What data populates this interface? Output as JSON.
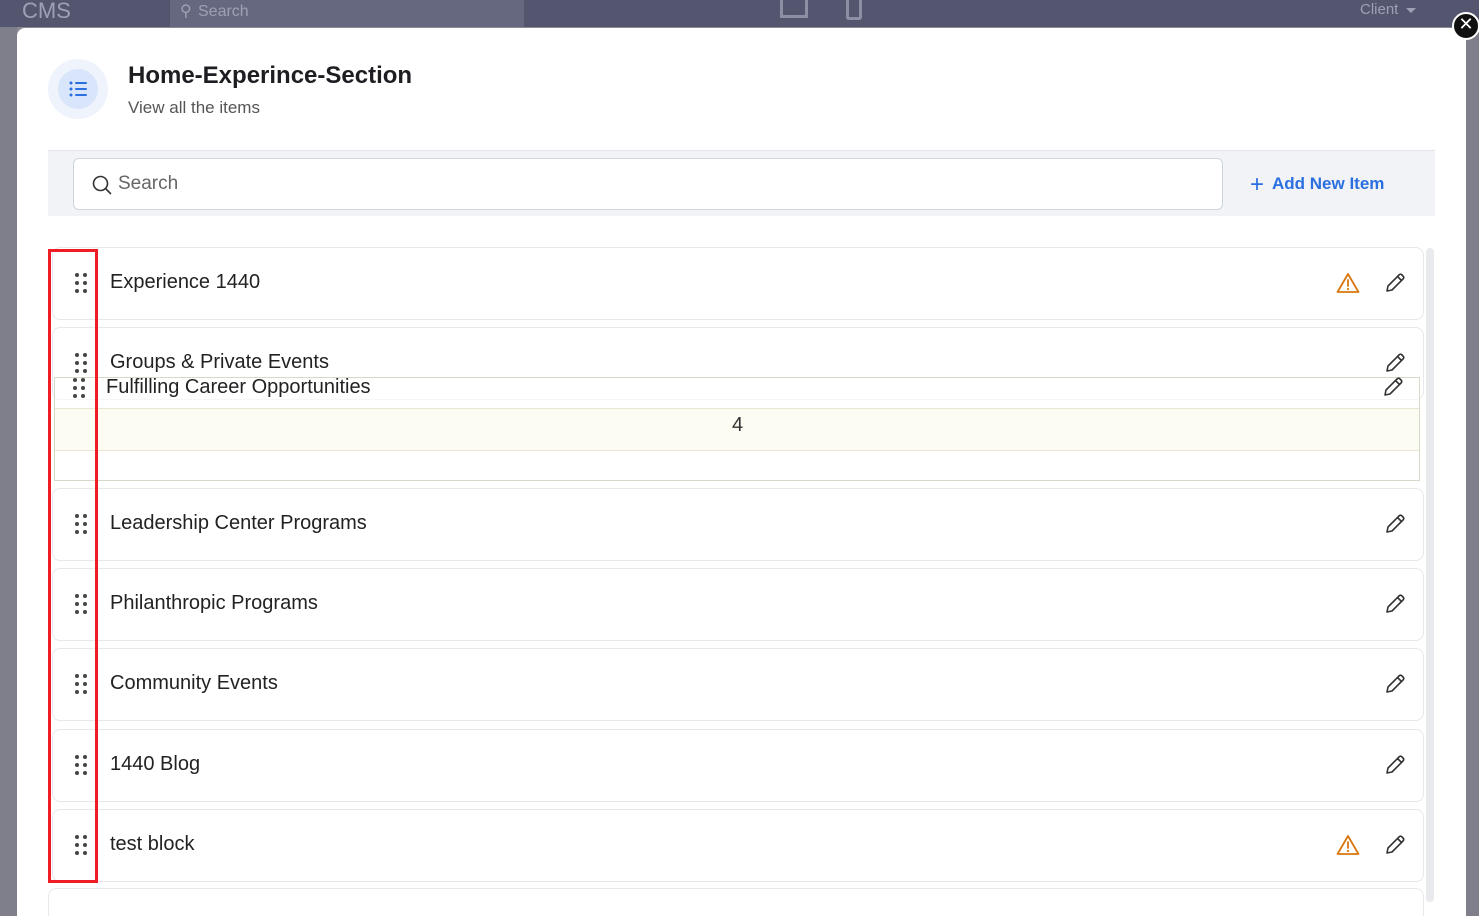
{
  "background": {
    "brand": "CMS",
    "search_placeholder": "Search",
    "client_label": "Client"
  },
  "header": {
    "title": "Home-Experince-Section",
    "subtitle": "View all the items"
  },
  "toolbar": {
    "search_placeholder": "Search",
    "add_label": "Add New Item",
    "add_color": "#2b6fe0"
  },
  "items": [
    {
      "label": "Experience 1440",
      "warning": true
    },
    {
      "label": "Groups & Private Events",
      "warning": false
    },
    {
      "label": "Leadership Center Programs",
      "warning": false
    },
    {
      "label": "Philanthropic Programs",
      "warning": false
    },
    {
      "label": "Community Events",
      "warning": false
    },
    {
      "label": "1440 Blog",
      "warning": false
    },
    {
      "label": "test block",
      "warning": true
    }
  ],
  "dragging_item": {
    "label": "Fulfilling Career Opportunities",
    "drop_index": "4"
  },
  "colors": {
    "warning": "#d9770f",
    "highlight": "#ee1c24"
  }
}
